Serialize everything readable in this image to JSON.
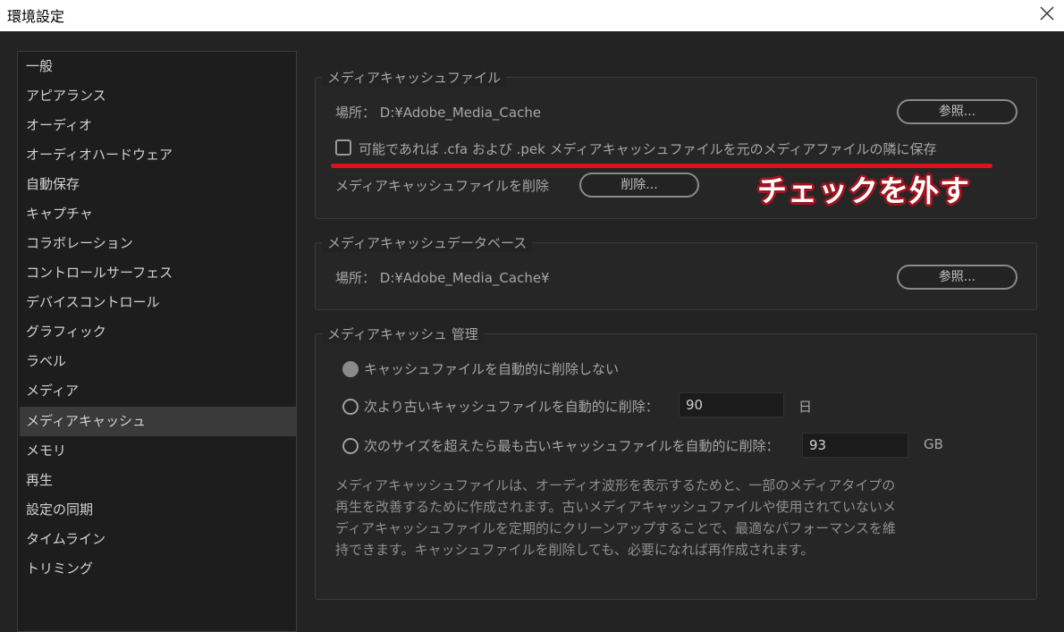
{
  "window": {
    "title": "環境設定",
    "close_icon": "close-icon"
  },
  "sidebar": {
    "items": [
      {
        "label": "一般"
      },
      {
        "label": "アピアランス"
      },
      {
        "label": "オーディオ"
      },
      {
        "label": "オーディオハードウェア"
      },
      {
        "label": "自動保存"
      },
      {
        "label": "キャプチャ"
      },
      {
        "label": "コラボレーション"
      },
      {
        "label": "コントロールサーフェス"
      },
      {
        "label": "デバイスコントロール"
      },
      {
        "label": "グラフィック"
      },
      {
        "label": "ラベル"
      },
      {
        "label": "メディア"
      },
      {
        "label": "メディアキャッシュ",
        "selected": true
      },
      {
        "label": "メモリ"
      },
      {
        "label": "再生"
      },
      {
        "label": "設定の同期"
      },
      {
        "label": "タイムライン"
      },
      {
        "label": "トリミング"
      }
    ]
  },
  "cache_files": {
    "title": "メディアキャッシュファイル",
    "location": "場所： D:¥Adobe_Media_Cache",
    "browse_label": "参照...",
    "save_next_checkbox": {
      "label": "可能であれば .cfa および .pek メディアキャッシュファイルを元のメディアファイルの隣に保存",
      "checked": false
    },
    "delete_label": "メディアキャッシュファイルを削除",
    "delete_button": "削除..."
  },
  "cache_db": {
    "title": "メディアキャッシュデータベース",
    "location": "場所： D:¥Adobe_Media_Cache¥",
    "browse_label": "参照..."
  },
  "cache_mgmt": {
    "title": "メディアキャッシュ 管理",
    "options": [
      {
        "label": "キャッシュファイルを自動的に削除しない",
        "selected": true
      },
      {
        "label": "次より古いキャッシュファイルを自動的に削除：",
        "value": "90",
        "unit": "日",
        "selected": false
      },
      {
        "label": "次のサイズを超えたら最も古いキャッシュファイルを自動的に削除：",
        "value": "93",
        "unit": "GB",
        "selected": false
      }
    ],
    "description": "メディアキャッシュファイルは、オーディオ波形を表示するためと、一部のメディアタイプの再生を改善するために作成されます。古いメディアキャッシュファイルや使用されていないメディアキャッシュファイルを定期的にクリーンアップすることで、最適なパフォーマンスを維持できます。キャッシュファイルを削除しても、必要になれば再作成されます。"
  },
  "annotation": {
    "text": "チェックを外す",
    "color": "#e0101a"
  }
}
